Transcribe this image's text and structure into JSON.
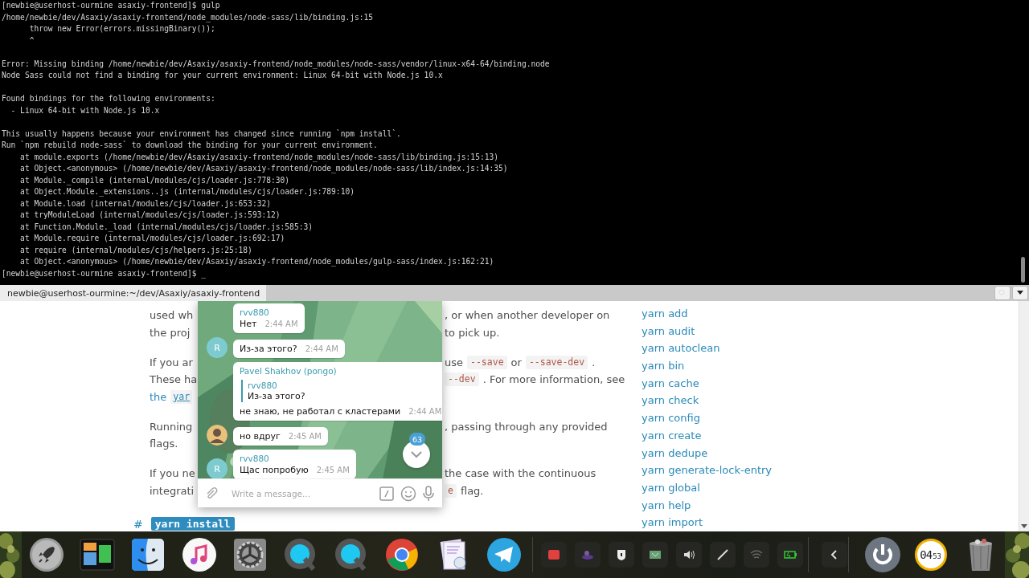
{
  "terminal": {
    "blocks": [
      [
        "[newbie@userhost-ourmine asaxiy-frontend]$ gulp",
        "/home/newbie/dev/Asaxiy/asaxiy-frontend/node_modules/node-sass/lib/binding.js:15",
        "      throw new Error(errors.missingBinary());",
        "      ^"
      ],
      [
        "Error: Missing binding /home/newbie/dev/Asaxiy/asaxiy-frontend/node_modules/node-sass/vendor/linux-x64-64/binding.node",
        "Node Sass could not find a binding for your current environment: Linux 64-bit with Node.js 10.x"
      ],
      [
        "Found bindings for the following environments:",
        "  - Linux 64-bit with Node.js 10.x"
      ],
      [
        "This usually happens because your environment has changed since running `npm install`.",
        "Run `npm rebuild node-sass` to download the binding for your current environment.",
        "    at module.exports (/home/newbie/dev/Asaxiy/asaxiy-frontend/node_modules/node-sass/lib/binding.js:15:13)",
        "    at Object.<anonymous> (/home/newbie/dev/Asaxiy/asaxiy-frontend/node_modules/node-sass/lib/index.js:14:35)",
        "    at Module._compile (internal/modules/cjs/loader.js:778:30)",
        "    at Object.Module._extensions..js (internal/modules/cjs/loader.js:789:10)",
        "    at Module.load (internal/modules/cjs/loader.js:653:32)",
        "    at tryModuleLoad (internal/modules/cjs/loader.js:593:12)",
        "    at Function.Module._load (internal/modules/cjs/loader.js:585:3)",
        "    at Module.require (internal/modules/cjs/loader.js:692:17)",
        "    at require (internal/modules/cjs/helpers.js:25:18)",
        "    at Object.<anonymous> (/home/newbie/dev/Asaxiy/asaxiy-frontend/node_modules/gulp-sass/index.js:162:21)",
        "[newbie@userhost-ourmine asaxiy-frontend]$ _"
      ]
    ]
  },
  "terminal_tabs": [
    {
      "title": "newbie@userhost-ourmine:~/dev/Asaxiy/asaxiy-frontend",
      "selected": true
    }
  ],
  "doc": {
    "paragraphs": [
      {
        "lines": [
          {
            "left": [
              {
                "kind": "text",
                "text": "used wh"
              }
            ],
            "right": [
              {
                "kind": "text",
                "text": ", or when another developer on"
              }
            ]
          },
          {
            "left": [
              {
                "kind": "text",
                "text": "the proj"
              }
            ],
            "right": [
              {
                "kind": "text",
                "text": "to pick up."
              }
            ]
          }
        ]
      },
      {
        "lines": [
          {
            "left": [
              {
                "kind": "text",
                "text": "If you ar"
              }
            ],
            "right": [
              {
                "kind": "text",
                "text": "use"
              },
              {
                "kind": "code",
                "text": "--save"
              },
              {
                "kind": "text",
                "text": "or"
              },
              {
                "kind": "code",
                "text": "--save-dev"
              },
              {
                "kind": "text",
                "text": "."
              }
            ]
          },
          {
            "left": [
              {
                "kind": "text",
                "text": "These ha"
              }
            ],
            "right": [
              {
                "kind": "code",
                "text": "--dev"
              },
              {
                "kind": "text",
                "text": ". For more information, see"
              }
            ]
          },
          {
            "left": [
              {
                "kind": "link",
                "text": "the"
              },
              {
                "kind": "link-code",
                "text": "yar"
              }
            ]
          }
        ]
      },
      {
        "lines": [
          {
            "left": [
              {
                "kind": "text",
                "text": "Running"
              }
            ],
            "right": [
              {
                "kind": "text",
                "text": ", passing through any provided"
              }
            ]
          },
          {
            "left": [
              {
                "kind": "text",
                "text": "flags."
              }
            ]
          }
        ]
      },
      {
        "lines": [
          {
            "left": [
              {
                "kind": "text",
                "text": "If you ne"
              }
            ],
            "right": [
              {
                "kind": "text",
                "text": "the case with the continuous"
              }
            ]
          },
          {
            "left": [
              {
                "kind": "text",
                "text": "integrati"
              }
            ],
            "right": [
              {
                "kind": "code",
                "text": "e"
              },
              {
                "kind": "text",
                "text": "flag."
              }
            ]
          }
        ]
      }
    ],
    "heading": {
      "hash": "#",
      "title": "yarn install"
    }
  },
  "sidebar": {
    "items": [
      "yarn add",
      "yarn audit",
      "yarn autoclean",
      "yarn bin",
      "yarn cache",
      "yarn check",
      "yarn config",
      "yarn create",
      "yarn dedupe",
      "yarn generate-lock-entry",
      "yarn global",
      "yarn help",
      "yarn import"
    ]
  },
  "chat": {
    "messages": [
      {
        "kind": "text",
        "sender": "rvv880",
        "text": "Нет",
        "time": "2:44 AM"
      },
      {
        "kind": "text",
        "text": "Из-за этого?",
        "time": "2:44 AM",
        "letter": "R"
      },
      {
        "kind": "reply",
        "sender": "Pavel Shakhov (pongo)",
        "quote_sender": "rvv880",
        "quote_text": "Из-за этого?",
        "text": "не знаю, не работал с кластерами",
        "time": "2:44 AM"
      },
      {
        "kind": "text",
        "text": "но вдруг",
        "time": "2:45 AM",
        "avatar_image": true
      },
      {
        "kind": "text",
        "sender": "rvv880",
        "text": "Щас попробую",
        "time": "2:45 AM",
        "letter": "R"
      }
    ],
    "unread_badge": "63",
    "input": {
      "placeholder": "Write a message..."
    }
  },
  "dock": {
    "clock": {
      "hours": "04",
      "minutes": "53"
    }
  }
}
